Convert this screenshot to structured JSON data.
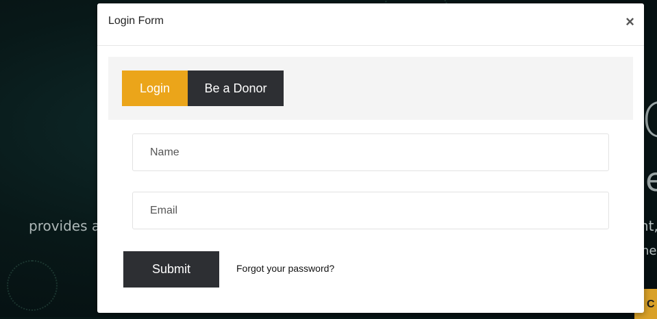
{
  "background": {
    "left_text": "provides a",
    "right_text_1": "nt,",
    "right_text_2": "ne",
    "glyph_1": "C",
    "glyph_2": "e",
    "cta_label": "C"
  },
  "modal": {
    "title": "Login Form",
    "close_icon": "×",
    "tabs": [
      {
        "label": "Login",
        "active": true
      },
      {
        "label": "Be a Donor",
        "active": false
      }
    ],
    "fields": {
      "name_placeholder": "Name",
      "email_placeholder": "Email"
    },
    "submit_label": "Submit",
    "forgot_label": "Forgot your password?"
  },
  "colors": {
    "accent": "#eba51a",
    "dark_button": "#2d2f33"
  }
}
